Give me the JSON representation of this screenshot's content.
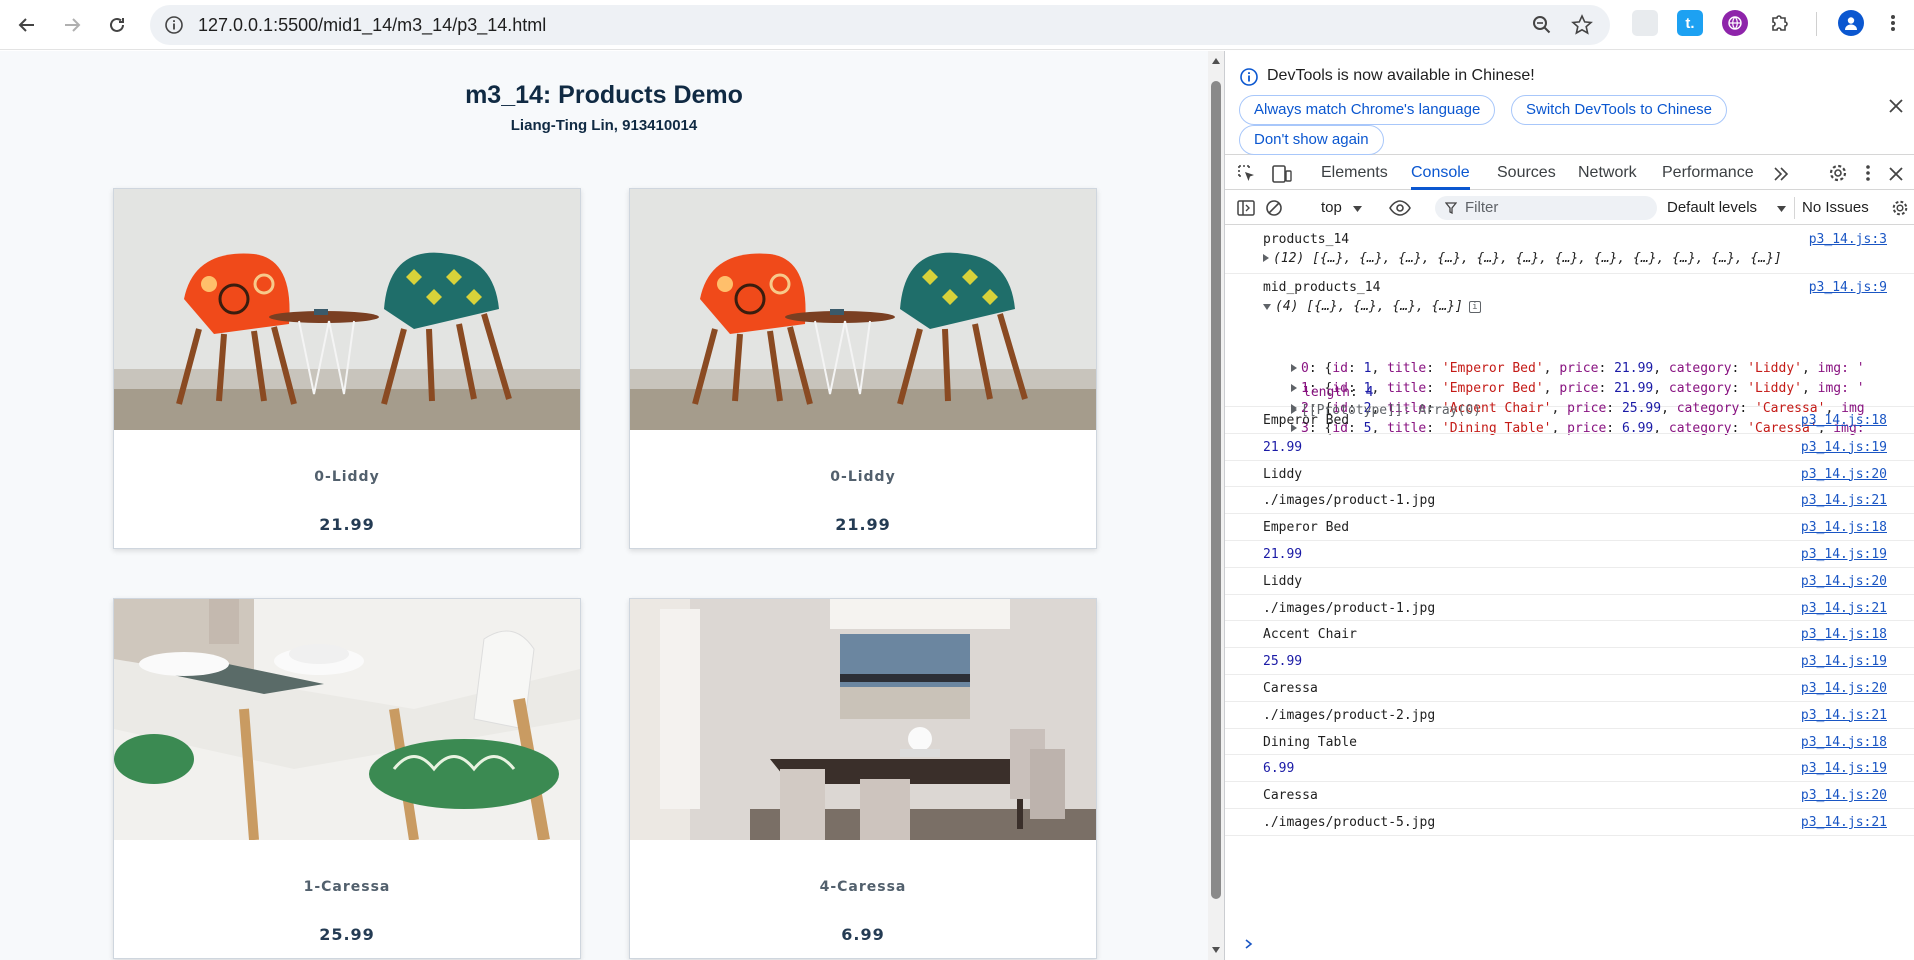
{
  "browser": {
    "url": "127.0.0.1:5500/mid1_14/m3_14/p3_14.html",
    "extension_badge": "t."
  },
  "page": {
    "title": "m3_14: Products Demo",
    "subtitle": "Liang-Ting Lin, 913410014",
    "products": [
      {
        "category": "0-Liddy",
        "price": "21.99",
        "image": "chairs"
      },
      {
        "category": "0-Liddy",
        "price": "21.99",
        "image": "chairs"
      },
      {
        "category": "1-Caressa",
        "price": "25.99",
        "image": "kitchen"
      },
      {
        "category": "4-Caressa",
        "price": "6.99",
        "image": "dining"
      }
    ]
  },
  "devtools": {
    "info": "DevTools is now available in Chinese!",
    "buttons": {
      "match": "Always match Chrome's language",
      "switch": "Switch DevTools to Chinese",
      "dont_show": "Don't show again"
    },
    "tabs": [
      "Elements",
      "Console",
      "Sources",
      "Network",
      "Performance"
    ],
    "active_tab": "Console",
    "context": "top",
    "filter_placeholder": "Filter",
    "levels": "Default levels",
    "issues": "No Issues",
    "console": {
      "products_label": "products_14",
      "products_src": "p3_14.js:3",
      "products_summary": "(12) [{…}, {…}, {…}, {…}, {…}, {…}, {…}, {…}, {…}, {…}, {…}, {…}]",
      "mid_label": "mid_products_14",
      "mid_src": "p3_14.js:9",
      "mid_summary": "(4) [{…}, {…}, {…}, {…}]",
      "items": [
        {
          "idx": "0",
          "id": "1",
          "title": "'Emperor Bed'",
          "price": "21.99",
          "category": "'Liddy'",
          "tail": "img: '"
        },
        {
          "idx": "1",
          "id": "1",
          "title": "'Emperor Bed'",
          "price": "21.99",
          "category": "'Liddy'",
          "tail": "img: '"
        },
        {
          "idx": "2",
          "id": "2",
          "title": "'Accent Chair'",
          "price": "25.99",
          "category": "'Caressa'",
          "tail": "img"
        },
        {
          "idx": "3",
          "id": "5",
          "title": "'Dining Table'",
          "price": "6.99",
          "category": "'Caressa'",
          "tail": "img:"
        }
      ],
      "length_label": "length",
      "length_value": "4",
      "prototype": "[[Prototype]]: Array(0)",
      "logs": [
        {
          "text": "Emperor Bed",
          "src": "p3_14.js:18",
          "kind": "str"
        },
        {
          "text": "21.99",
          "src": "p3_14.js:19",
          "kind": "num"
        },
        {
          "text": "Liddy",
          "src": "p3_14.js:20",
          "kind": "str"
        },
        {
          "text": "./images/product-1.jpg",
          "src": "p3_14.js:21",
          "kind": "str"
        },
        {
          "text": "Emperor Bed",
          "src": "p3_14.js:18",
          "kind": "str"
        },
        {
          "text": "21.99",
          "src": "p3_14.js:19",
          "kind": "num"
        },
        {
          "text": "Liddy",
          "src": "p3_14.js:20",
          "kind": "str"
        },
        {
          "text": "./images/product-1.jpg",
          "src": "p3_14.js:21",
          "kind": "str"
        },
        {
          "text": "Accent Chair",
          "src": "p3_14.js:18",
          "kind": "str"
        },
        {
          "text": "25.99",
          "src": "p3_14.js:19",
          "kind": "num"
        },
        {
          "text": "Caressa",
          "src": "p3_14.js:20",
          "kind": "str"
        },
        {
          "text": "./images/product-2.jpg",
          "src": "p3_14.js:21",
          "kind": "str"
        },
        {
          "text": "Dining Table",
          "src": "p3_14.js:18",
          "kind": "str"
        },
        {
          "text": "6.99",
          "src": "p3_14.js:19",
          "kind": "num"
        },
        {
          "text": "Caressa",
          "src": "p3_14.js:20",
          "kind": "str"
        },
        {
          "text": "./images/product-5.jpg",
          "src": "p3_14.js:21",
          "kind": "str"
        }
      ]
    }
  },
  "colors": {
    "accent": "#0b57d0",
    "page_bg": "#f7f9fb",
    "heading": "#102a43"
  }
}
